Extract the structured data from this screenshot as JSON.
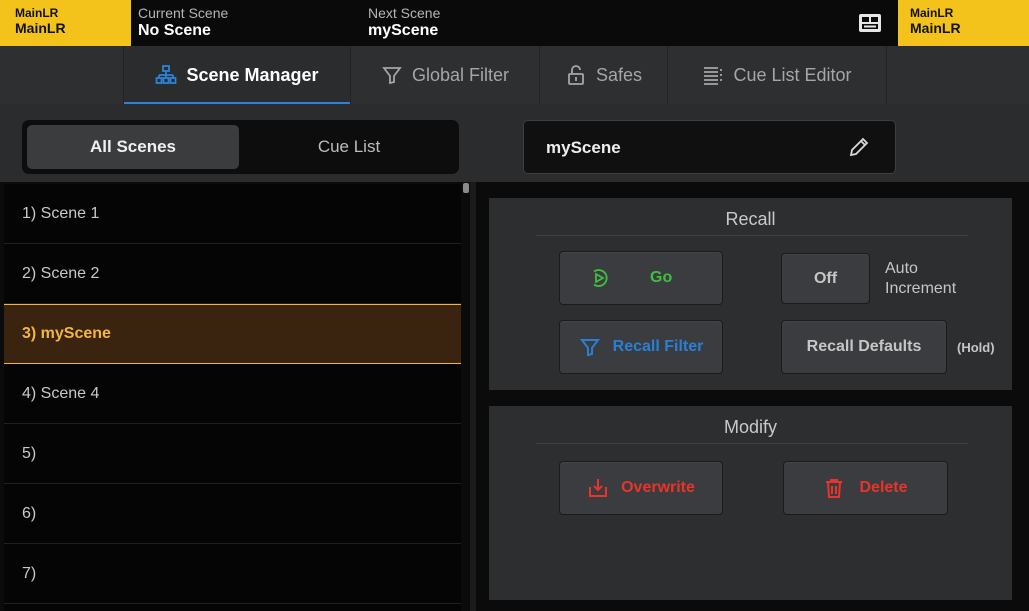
{
  "top_bar": {
    "main_left": {
      "line1": "MainLR",
      "line2": "MainLR"
    },
    "current_scene": {
      "caption": "Current Scene",
      "value": "No Scene"
    },
    "next_scene": {
      "caption": "Next Scene",
      "value": "myScene"
    },
    "sd_icon": "sd-card-icon",
    "main_right": {
      "line1": "MainLR",
      "line2": "MainLR"
    },
    "accent_color": "#f3c31b"
  },
  "tabs": [
    {
      "label": "Scene Manager",
      "icon": "hierarchy-icon",
      "active": true
    },
    {
      "label": "Global Filter",
      "icon": "filter-icon",
      "active": false
    },
    {
      "label": "Safes",
      "icon": "padlock-icon",
      "active": false
    },
    {
      "label": "Cue List Editor",
      "icon": "list-icon",
      "active": false
    }
  ],
  "view_toggle": {
    "options": [
      "All Scenes",
      "Cue List"
    ],
    "selected": "All Scenes"
  },
  "scene_name_field": {
    "value": "myScene",
    "icon": "pencil-icon"
  },
  "scene_list": {
    "items": [
      "1) Scene 1",
      "2) Scene 2",
      "3) myScene",
      "4) Scene 4",
      "5)",
      "6)",
      "7)"
    ],
    "selected": "3) myScene",
    "selected_color": "#f2b640"
  },
  "recall_panel": {
    "title": "Recall",
    "go_label": "Go",
    "go_icon": "play-circle-icon",
    "auto_increment_value": "Off",
    "auto_increment_label_1": "Auto",
    "auto_increment_label_2": "Increment",
    "recall_filter_label": "Recall Filter",
    "recall_filter_icon": "filter-icon",
    "recall_defaults_label": "Recall Defaults",
    "hold_note": "(Hold)",
    "go_color": "#3fbf3f",
    "filter_color": "#2a7fd4"
  },
  "modify_panel": {
    "title": "Modify",
    "overwrite_label": "Overwrite",
    "overwrite_icon": "save-arrow-icon",
    "delete_label": "Delete",
    "delete_icon": "trash-icon",
    "danger_color": "#e8342a"
  }
}
